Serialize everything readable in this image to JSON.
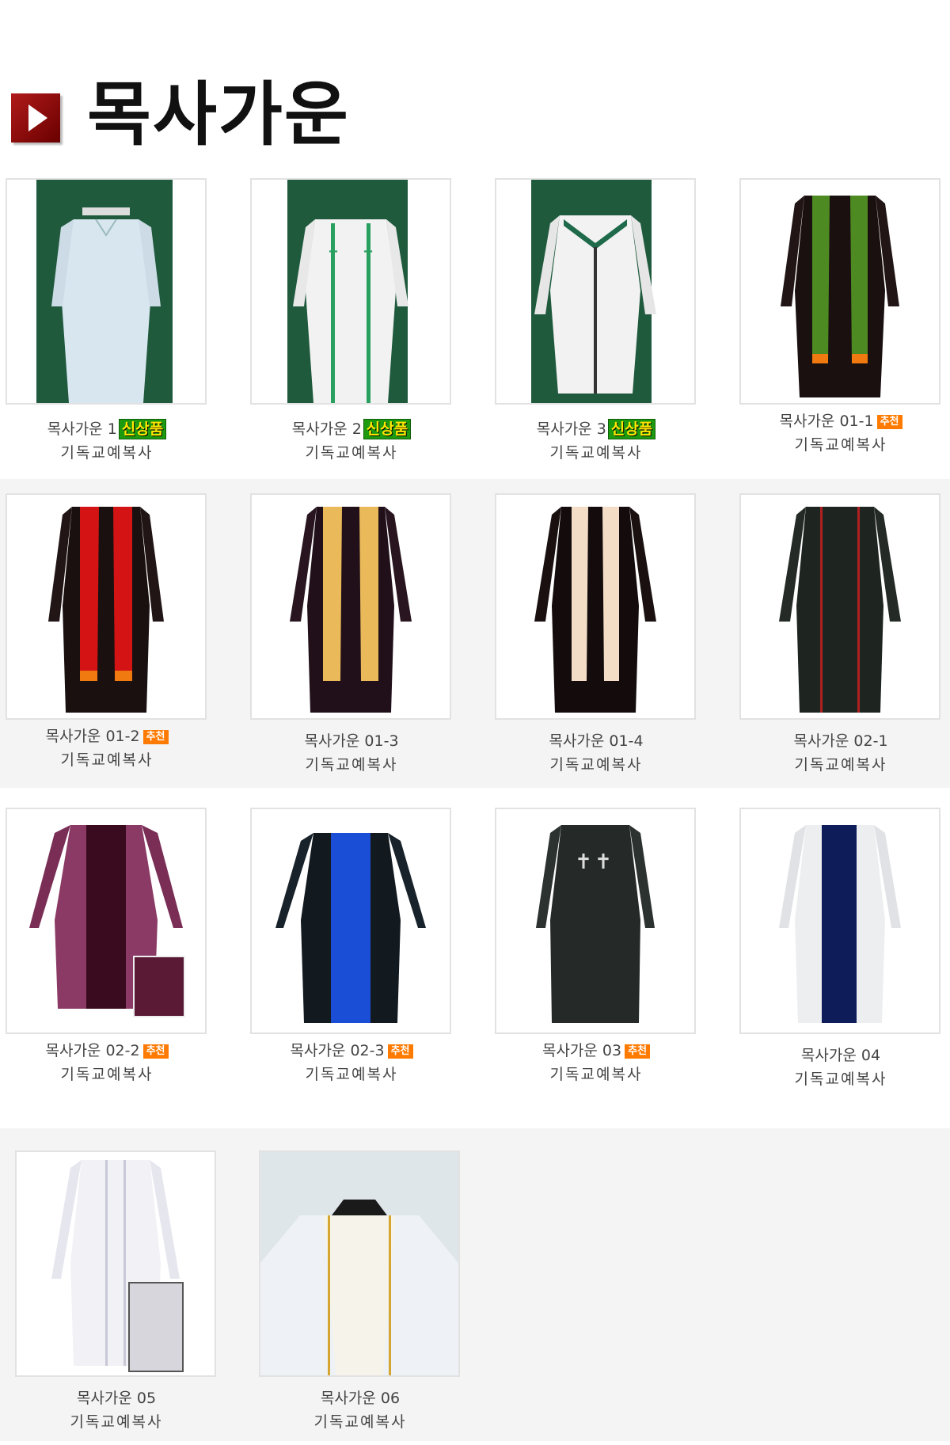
{
  "page": {
    "title": "목사가운"
  },
  "badges": {
    "new": "신상품",
    "recommended": "추천"
  },
  "products": [
    {
      "name": "목사가운 1",
      "seller": "기독교예복사",
      "badge": "new"
    },
    {
      "name": "목사가운 2",
      "seller": "기독교예복사",
      "badge": "new"
    },
    {
      "name": "목사가운 3",
      "seller": "기독교예복사",
      "badge": "new"
    },
    {
      "name": "목사가운 01-1",
      "seller": "기독교예복사",
      "badge": "recommended"
    },
    {
      "name": "목사가운 01-2",
      "seller": "기독교예복사",
      "badge": "recommended"
    },
    {
      "name": "목사가운 01-3",
      "seller": "기독교예복사",
      "badge": ""
    },
    {
      "name": "목사가운 01-4",
      "seller": "기독교예복사",
      "badge": ""
    },
    {
      "name": "목사가운 02-1",
      "seller": "기독교예복사",
      "badge": ""
    },
    {
      "name": "목사가운 02-2",
      "seller": "기독교예복사",
      "badge": "recommended"
    },
    {
      "name": "목사가운 02-3",
      "seller": "기독교예복사",
      "badge": "recommended"
    },
    {
      "name": "목사가운 03",
      "seller": "기독교예복사",
      "badge": "recommended"
    },
    {
      "name": "목사가운 04",
      "seller": "기독교예복사",
      "badge": ""
    },
    {
      "name": "목사가운 05",
      "seller": "기독교예복사",
      "badge": ""
    },
    {
      "name": "목사가운 06",
      "seller": "기독교예복사",
      "badge": ""
    }
  ]
}
